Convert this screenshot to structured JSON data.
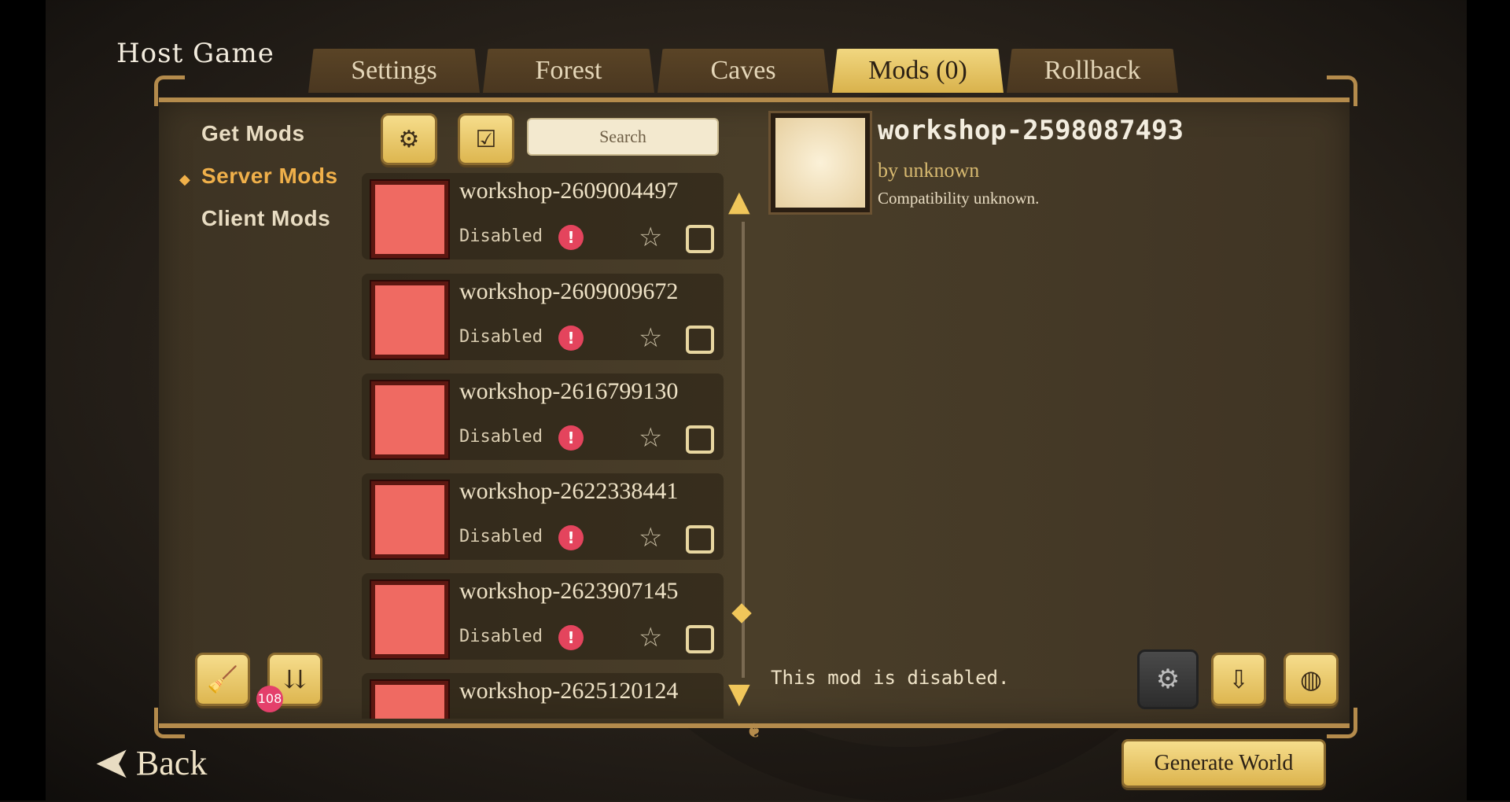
{
  "header": {
    "title": "Host Game"
  },
  "tabs": [
    {
      "label": "Settings",
      "active": false
    },
    {
      "label": "Forest",
      "active": false
    },
    {
      "label": "Caves",
      "active": false
    },
    {
      "label": "Mods (0)",
      "active": true
    },
    {
      "label": "Rollback",
      "active": false
    }
  ],
  "sidebar": {
    "items": [
      {
        "label": "Get Mods",
        "active": false
      },
      {
        "label": "Server Mods",
        "active": true
      },
      {
        "label": "Client Mods",
        "active": false
      }
    ]
  },
  "search": {
    "placeholder": "Search"
  },
  "mods": [
    {
      "name": "workshop-2609004497",
      "status": "Disabled"
    },
    {
      "name": "workshop-2609009672",
      "status": "Disabled"
    },
    {
      "name": "workshop-2616799130",
      "status": "Disabled"
    },
    {
      "name": "workshop-2622338441",
      "status": "Disabled"
    },
    {
      "name": "workshop-2623907145",
      "status": "Disabled"
    },
    {
      "name": "workshop-2625120124",
      "status": ""
    }
  ],
  "tools": {
    "update_count": "108"
  },
  "detail": {
    "title": "workshop-2598087493",
    "author": "by unknown",
    "compatibility": "Compatibility unknown.",
    "message": "This mod is disabled."
  },
  "footer": {
    "back_label": "Back",
    "generate_label": "Generate World"
  },
  "colors": {
    "accent": "#f0b04a",
    "tab_active": "#e5c25f",
    "mod_thumb": "#ef6a62",
    "warning": "#e4445d"
  }
}
